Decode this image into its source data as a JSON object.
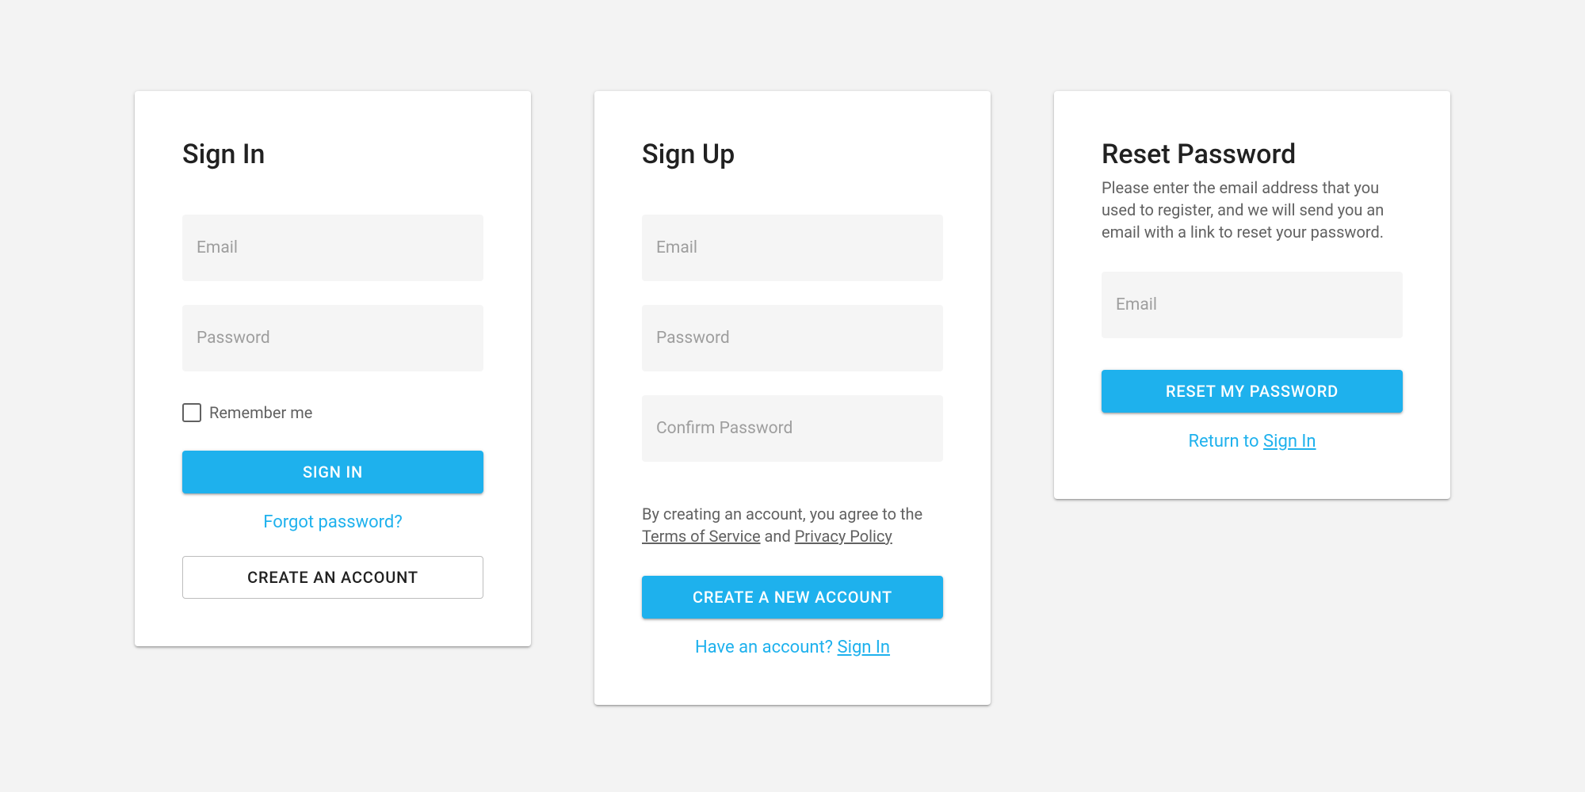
{
  "signin": {
    "title": "Sign In",
    "email_placeholder": "Email",
    "password_placeholder": "Password",
    "remember_label": "Remember me",
    "submit_label": "Sign In",
    "forgot_label": "Forgot password?",
    "create_label": "Create an Account"
  },
  "signup": {
    "title": "Sign Up",
    "email_placeholder": "Email",
    "password_placeholder": "Password",
    "confirm_placeholder": "Confirm Password",
    "legal_prefix": "By creating an account, you agree to the ",
    "terms_label": "Terms of Service",
    "legal_and": " and ",
    "privacy_label": "Privacy Policy",
    "submit_label": "Create a New Account",
    "have_account_prefix": "Have an account? ",
    "signin_link": "Sign In"
  },
  "reset": {
    "title": "Reset Password",
    "description": "Please enter the email address that you used to register, and we will send you an email with a link to reset your password.",
    "email_placeholder": "Email",
    "submit_label": "Reset My Password",
    "return_prefix": "Return to ",
    "signin_link": "Sign In"
  }
}
